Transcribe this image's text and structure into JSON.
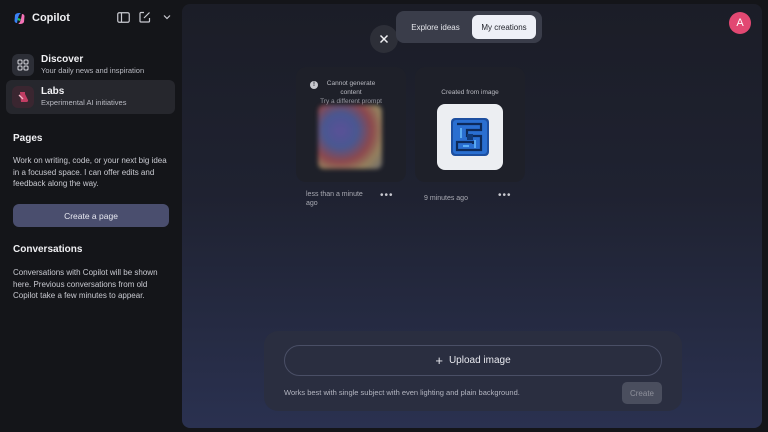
{
  "app": {
    "name": "Copilot"
  },
  "sidebar": {
    "nav": [
      {
        "title": "Discover",
        "subtitle": "Your daily news and inspiration",
        "icon": "grid-icon"
      },
      {
        "title": "Labs",
        "subtitle": "Experimental AI initiatives",
        "icon": "flask-icon",
        "active": true
      }
    ],
    "pages": {
      "title": "Pages",
      "body": "Work on writing, code, or your next big idea in a focused space. I can offer edits and feedback along the way.",
      "button": "Create a page"
    },
    "conversations": {
      "title": "Conversations",
      "body": "Conversations with Copilot will be shown here. Previous conversations from old Copilot take a few minutes to appear."
    }
  },
  "header": {
    "tabs": [
      "Explore ideas",
      "My creations"
    ],
    "active_tab": "My creations",
    "avatar_initial": "A"
  },
  "creations": [
    {
      "status_title": "Cannot generate content",
      "status_sub": "Try a different prompt",
      "time": "less than a minute ago"
    },
    {
      "status_title": "Created from image",
      "time": "9 minutes ago"
    }
  ],
  "upload": {
    "button": "Upload image",
    "hint": "Works best with single subject with even lighting and plain background.",
    "create": "Create"
  },
  "colors": {
    "avatar": "#e24872",
    "accent_button": "#4a4e6e"
  }
}
